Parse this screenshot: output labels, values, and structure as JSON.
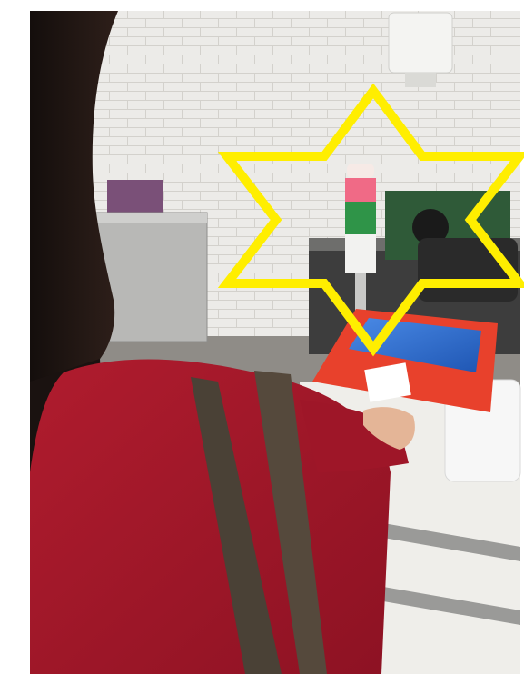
{
  "scene": {
    "colors": {
      "wall": "#e9e7e4",
      "star_outline": "#ffee00",
      "kiosk_body": "#e8412c",
      "kiosk_screen": "#2f6fd1",
      "shirt": "#a8182a",
      "hair": "#1c1412",
      "bag_strap": "#4a4136"
    },
    "icons": {
      "star": "hexagram-outline-icon"
    }
  }
}
